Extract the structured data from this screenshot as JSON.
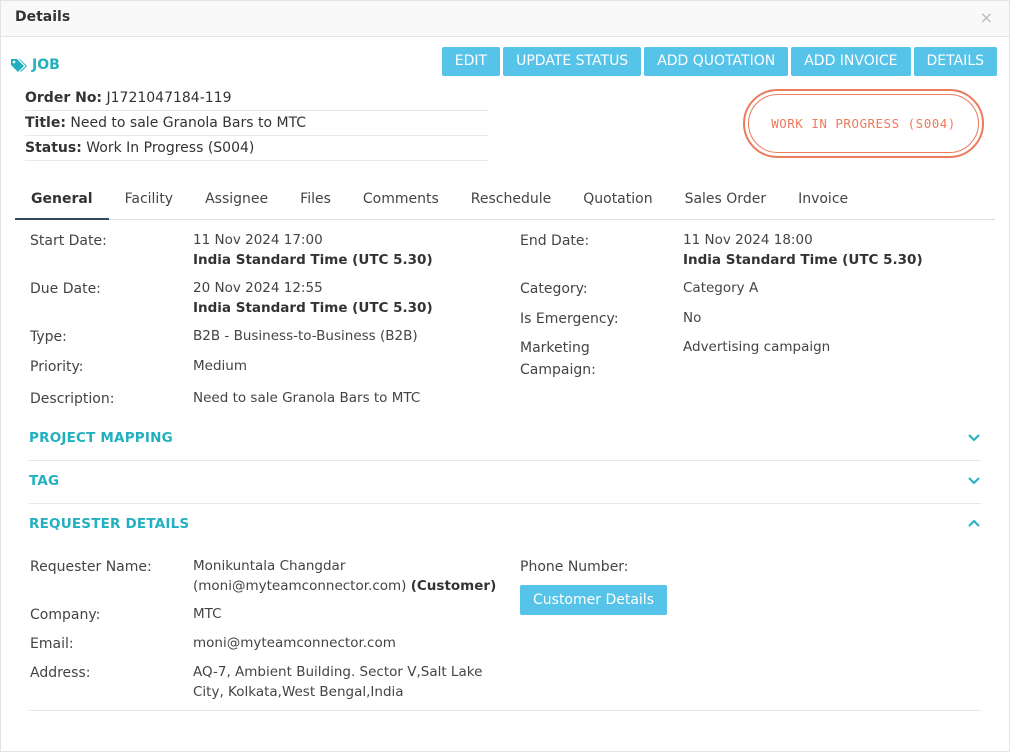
{
  "modal": {
    "title": "Details",
    "close": "×"
  },
  "job": {
    "label": "JOB"
  },
  "actions": [
    "EDIT",
    "UPDATE STATUS",
    "ADD QUOTATION",
    "ADD INVOICE",
    "DETAILS"
  ],
  "meta": {
    "order_label": "Order No:",
    "order_value": "J1721047184-119",
    "title_label": "Title:",
    "title_value": "Need to sale Granola Bars to MTC",
    "status_label": "Status:",
    "status_value": "Work In Progress (S004)"
  },
  "stamp": {
    "text": "WORK IN PROGRESS (S004)",
    "color": "#ec7a5c"
  },
  "tabs": [
    "General",
    "Facility",
    "Assignee",
    "Files",
    "Comments",
    "Reschedule",
    "Quotation",
    "Sales Order",
    "Invoice"
  ],
  "general": {
    "start_label": "Start Date:",
    "start_date": "11 Nov 2024 17:00",
    "start_tz": "India Standard Time (UTC 5.30)",
    "due_label": "Due Date:",
    "due_date": "20 Nov 2024 12:55",
    "due_tz": "India Standard Time (UTC 5.30)",
    "type_label": "Type:",
    "type_value": "B2B - Business-to-Business (B2B)",
    "priority_label": "Priority:",
    "priority_value": "Medium",
    "description_label": "Description:",
    "description_value": "Need to sale Granola Bars to MTC",
    "end_label": "End Date:",
    "end_date": "11 Nov 2024 18:00",
    "end_tz": "India Standard Time (UTC 5.30)",
    "category_label": "Category:",
    "category_value": "Category A",
    "emergency_label": "Is Emergency:",
    "emergency_value": "No",
    "marketing_label_1": "Marketing",
    "marketing_label_2": "Campaign:",
    "marketing_value": "Advertising campaign"
  },
  "sections": {
    "project_mapping": "PROJECT MAPPING",
    "tag": "TAG",
    "requester": "REQUESTER DETAILS"
  },
  "requester": {
    "name_label": "Requester Name:",
    "name_value": "Monikuntala Changdar",
    "name_email": "(moni@myteamconnector.com)",
    "name_role": "(Customer)",
    "company_label": "Company:",
    "company_value": "MTC",
    "email_label": "Email:",
    "email_value": "moni@myteamconnector.com",
    "address_label": "Address:",
    "address_line1": "AQ-7, Ambient Building. Sector V,Salt Lake",
    "address_line2": "City, Kolkata,West Bengal,India",
    "phone_label": "Phone Number:",
    "customer_button": "Customer Details"
  },
  "colors": {
    "accent": "#22b0c0",
    "button": "#56c4e8",
    "stamp": "#ec7a5c"
  }
}
